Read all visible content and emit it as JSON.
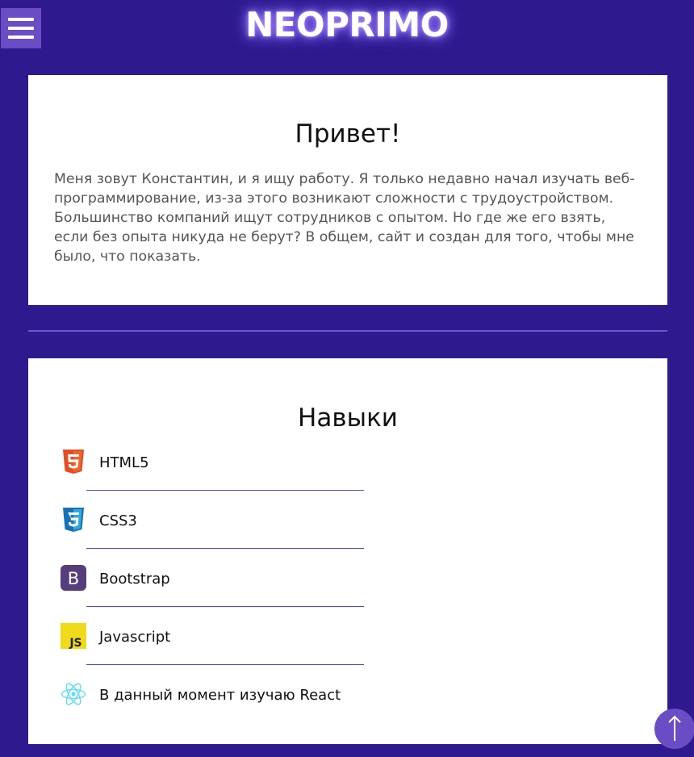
{
  "header": {
    "logo": "NEOPRIMO",
    "menu_icon": "hamburger-menu-icon"
  },
  "intro": {
    "title": "Привет!",
    "text": "Меня зовут Константин, и я ищу работу. Я только недавно начал изучать веб-программирование, из-за этого возникают сложности с трудоустройством. Большинство компаний ищут сотрудников с опытом. Но где же его взять, если без опыта никуда не берут? В общем, сайт и создан для того, чтобы мне было, что показать."
  },
  "skills": {
    "title": "Навыки",
    "items": [
      {
        "label": "HTML5",
        "icon": "html5-icon"
      },
      {
        "label": "CSS3",
        "icon": "css3-icon"
      },
      {
        "label": "Bootstrap",
        "icon": "bootstrap-icon"
      },
      {
        "label": "Javascript",
        "icon": "javascript-icon"
      },
      {
        "label": "В данный момент изучаю React",
        "icon": "react-icon"
      }
    ]
  },
  "scroll_top": {
    "icon": "arrow-up-icon"
  },
  "colors": {
    "background": "#2e1a8e",
    "accent": "#6a4cc4",
    "card": "#ffffff",
    "divider": "#6b55d6"
  }
}
